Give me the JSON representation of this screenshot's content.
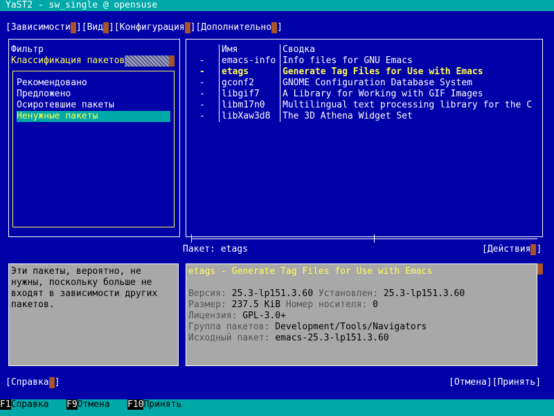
{
  "window": {
    "title": "YaST2 - sw_single @ opensuse"
  },
  "menu": {
    "items": [
      {
        "label": "Зависимости"
      },
      {
        "label": "Вид"
      },
      {
        "label": "Конфигурация"
      },
      {
        "label": "Дополнительно"
      }
    ]
  },
  "filter": {
    "label": "Фильтр",
    "selected": "Классификация пакетов",
    "options": [
      "Рекомендовано",
      "Предложено",
      "Осиротевшие пакеты",
      "Ненужные пакеты"
    ],
    "selected_index": 3
  },
  "packages": {
    "headers": {
      "name": "Имя",
      "summary": "Сводка"
    },
    "rows": [
      {
        "status": "-",
        "name": "emacs-info",
        "summary": "Info files for GNU Emacs"
      },
      {
        "status": "-",
        "name": "etags",
        "summary": "Generate Tag Files for Use with Emacs"
      },
      {
        "status": "-",
        "name": "gconf2",
        "summary": "GNOME Configuration Database System"
      },
      {
        "status": "-",
        "name": "libgif7",
        "summary": "A Library for Working with GIF Images"
      },
      {
        "status": "-",
        "name": "libm17n0",
        "summary": "Multilingual text processing library for the C"
      },
      {
        "status": "-",
        "name": "libXaw3d8",
        "summary": "The 3D Athena Widget Set"
      }
    ],
    "current_label": "Пакет: etags",
    "actions_label": "Действия"
  },
  "description": {
    "lines": [
      "Эти пакеты, вероятно, не",
      "нужны, поскольку больше не",
      "входят в зависимости других",
      "пакетов."
    ]
  },
  "info": {
    "heading": "etags - Generate Tag Files for Use with Emacs",
    "version_key": "Версия:",
    "version_val": "25.3-lp151.3.60",
    "installed_key": "Установлен:",
    "installed_val": "25.3-lp151.3.60",
    "size_key": "Размер:",
    "size_val": "237.5 KiB",
    "media_key": "Номер носителя:",
    "media_val": "0",
    "license_key": "Лицензия:",
    "license_val": "GPL-3.0+",
    "group_key": "Группа пакетов:",
    "group_val": "Development/Tools/Navigators",
    "source_key": "Исходный пакет:",
    "source_val": "emacs-25.3-lp151.3.60"
  },
  "buttons": {
    "help": "Справка",
    "cancel": "Отмена",
    "accept": "Принять"
  },
  "fkeys": [
    {
      "key": "F1",
      "label": "Справка"
    },
    {
      "key": "F9",
      "label": "Отмена"
    },
    {
      "key": "F10",
      "label": "Принять"
    }
  ]
}
